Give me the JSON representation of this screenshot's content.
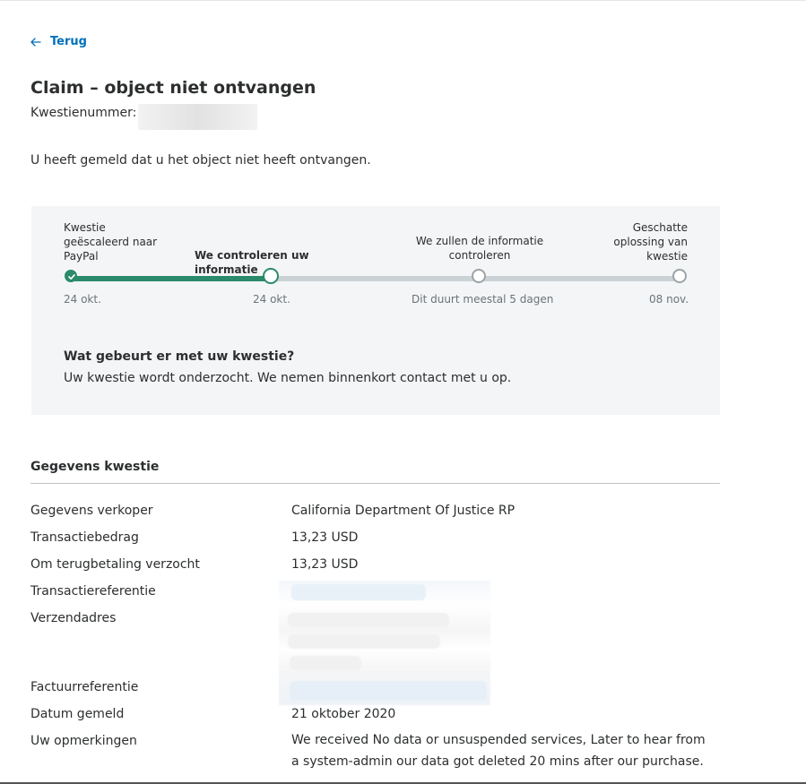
{
  "back_link": {
    "label": "Terug"
  },
  "page": {
    "title": "Claim – object niet ontvangen",
    "case_number_label": "Kwestienummer:",
    "intro": "U heeft gemeld dat u het object niet heeft ontvangen."
  },
  "status": {
    "steps": [
      {
        "title": "Kwestie geëscaleerd naar PayPal",
        "date": "24 okt.",
        "state": "done"
      },
      {
        "title": "We controleren uw informatie",
        "date": "24 okt.",
        "state": "current"
      },
      {
        "title": "We zullen de informatie controleren",
        "date": "Dit duurt meestal 5 dagen",
        "state": "pending"
      },
      {
        "title": "Geschatte oplossing van kwestie",
        "date": "08 nov.",
        "state": "pending"
      }
    ],
    "progress_fraction": 0.33,
    "what_happens_title": "Wat gebeurt er met uw kwestie?",
    "what_happens_text": "Uw kwestie wordt onderzocht. We nemen binnenkort contact met u op."
  },
  "details": {
    "heading": "Gegevens kwestie",
    "rows": [
      {
        "label": "Gegevens verkoper",
        "value": "California Department Of Justice RP"
      },
      {
        "label": "Transactiebedrag",
        "value": "13,23 USD"
      },
      {
        "label": "Om terugbetaling verzocht",
        "value": "13,23 USD"
      },
      {
        "label": "Transactiereferentie",
        "value": ""
      },
      {
        "label": "Verzendadres",
        "value": ""
      },
      {
        "label": "Factuurreferentie",
        "value": ""
      },
      {
        "label": "Datum gemeld",
        "value": "21 oktober 2020"
      },
      {
        "label": "Uw opmerkingen",
        "value": "We received No data or unsuspended services, Later to hear from a system-admin our data got deleted 20 mins after our purchase."
      }
    ]
  },
  "colors": {
    "accent_link": "#0070ba",
    "progress_green": "#2b8a6a",
    "track_gray": "#cbd2d6",
    "panel_bg": "#f3f5f7"
  }
}
